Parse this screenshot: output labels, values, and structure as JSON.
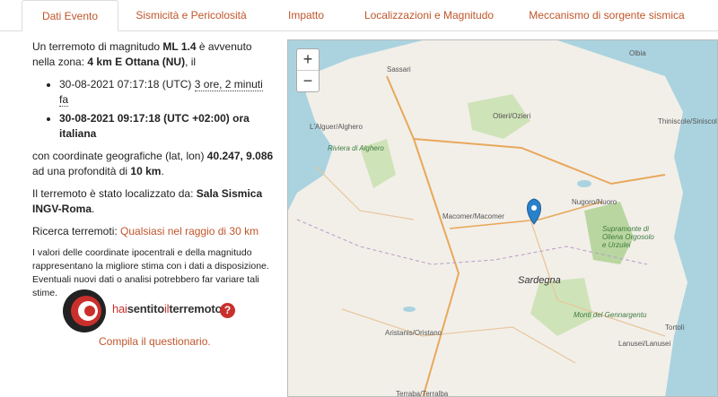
{
  "tabs": [
    {
      "label": "Dati Evento",
      "active": true
    },
    {
      "label": "Sismicità e Pericolosità",
      "active": false
    },
    {
      "label": "Impatto",
      "active": false
    },
    {
      "label": "Localizzazioni e Magnitudo",
      "active": false
    },
    {
      "label": "Meccanismo di sorgente sismica",
      "active": false
    }
  ],
  "event": {
    "intro_1": "Un terremoto di magnitudo ",
    "magnitude": "ML 1.4",
    "intro_2": " è avvenuto nella zona: ",
    "zone": "4 km E Ottana (NU)",
    "intro_3": ", il",
    "time_utc": "30-08-2021 07:17:18 (UTC)",
    "time_ago": "3 ore, 2 minuti fa",
    "time_local": "30-08-2021 09:17:18 (UTC +02:00) ora italiana",
    "coord_1": "con coordinate geografiche (lat, lon) ",
    "coords": "40.247, 9.086",
    "coord_2": " ad una profondità di ",
    "depth": "10 km",
    "coord_3": ".",
    "loc_1": "Il terremoto è stato localizzato da: ",
    "loc_by": "Sala Sismica INGV-Roma",
    "loc_2": ".",
    "search_label": "Ricerca terremoti: ",
    "search_link": "Qualsiasi nel raggio di 30 km",
    "note": "I valori delle coordinate ipocentrali e della magnitudo rappresentano la migliore stima con i dati a disposizione. Eventuali nuovi dati o analisi potrebbero far variare tali stime."
  },
  "logo": {
    "text_a": "hai",
    "text_b": "sentito",
    "text_c": "il",
    "text_d": "terremoto",
    "help": "?"
  },
  "compila": "Compila il questionario.",
  "map": {
    "zoom_in": "+",
    "zoom_out": "−",
    "labels": [
      {
        "id": "sassari",
        "text": "Sassari"
      },
      {
        "id": "olbia",
        "text": "Olbia"
      },
      {
        "id": "alghero",
        "text": "L'Alguer/Alghero"
      },
      {
        "id": "capocaccia",
        "text": "Riviera di Alghero"
      },
      {
        "id": "ozieri",
        "text": "Otieri/Ozieri"
      },
      {
        "id": "siniscola",
        "text": "Thiniscole/Siniscola"
      },
      {
        "id": "nuoro",
        "text": "Nugoro/Nuoro"
      },
      {
        "id": "macomer",
        "text": "Macomer/Macomer"
      },
      {
        "id": "sardegna",
        "text": "Sardegna"
      },
      {
        "id": "gennargentu",
        "text": "Monti del Gennargentu"
      },
      {
        "id": "orosei",
        "text": "Supramonte di Oliena Orgosolo e Urzulei"
      },
      {
        "id": "oristano",
        "text": "Aristanis/Oristano"
      },
      {
        "id": "tortoli",
        "text": "Tortolì"
      },
      {
        "id": "lanusei",
        "text": "Lanusei/Lanusei"
      },
      {
        "id": "terralba",
        "text": "Terraba/Terralba"
      }
    ]
  }
}
